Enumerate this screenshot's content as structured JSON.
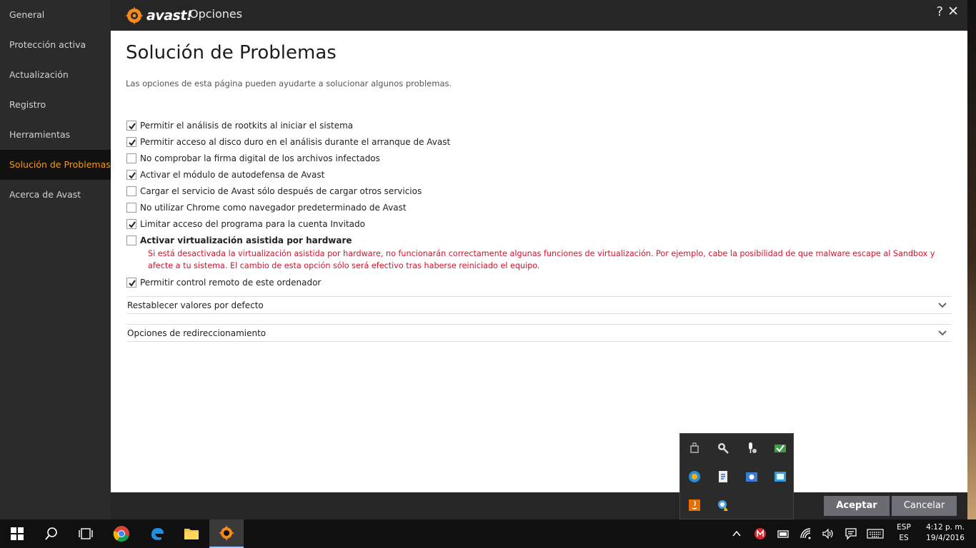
{
  "window": {
    "brand": "avast!",
    "title": "Opciones",
    "help_label": "?",
    "close_label": "✕"
  },
  "sidebar": {
    "items": [
      {
        "label": "General",
        "active": false
      },
      {
        "label": "Protección activa",
        "active": false
      },
      {
        "label": "Actualización",
        "active": false
      },
      {
        "label": "Registro",
        "active": false
      },
      {
        "label": "Herramientas",
        "active": false
      },
      {
        "label": "Solución de Problemas",
        "active": true
      },
      {
        "label": "Acerca de Avast",
        "active": false
      }
    ]
  },
  "main": {
    "title": "Solución de Problemas",
    "subtitle": "Las opciones de esta página pueden ayudarte a solucionar algunos problemas.",
    "options": [
      {
        "label": "Permitir el análisis de rootkits al iniciar el sistema",
        "checked": true
      },
      {
        "label": "Permitir acceso al disco duro en el análisis durante el arranque de Avast",
        "checked": true
      },
      {
        "label": "No comprobar la firma digital de los archivos infectados",
        "checked": false
      },
      {
        "label": "Activar el módulo de autodefensa de Avast",
        "checked": true
      },
      {
        "label": "Cargar el servicio de Avast sólo después de cargar otros servicios",
        "checked": false
      },
      {
        "label": "No utilizar Chrome como navegador predeterminado de Avast",
        "checked": false
      },
      {
        "label": "Limitar acceso del programa para la cuenta Invitado",
        "checked": true
      },
      {
        "label": "Activar virtualización asistida por hardware",
        "checked": false,
        "bold": true
      },
      {
        "label": "Permitir control remoto de este ordenador",
        "checked": true
      }
    ],
    "warning": "Si está desactivada la virtualización asistida por hardware, no funcionarán correctamente algunas funciones de virtualización. Por ejemplo, cabe la posibilidad de que malware escape al Sandbox y afecte a tu sistema. El cambio de esta opción sólo será efectivo tras haberse reiniciado el equipo.",
    "sections": [
      {
        "label": "Restablecer valores por defecto"
      },
      {
        "label": "Opciones de redireccionamiento"
      }
    ]
  },
  "buttons": {
    "accept": "Aceptar",
    "cancel": "Cancelar"
  },
  "colors": {
    "accent": "#f39a1e",
    "warning": "#d3132b",
    "sidebar_bg": "#2b2b2b"
  },
  "tray_popup": {
    "icons": [
      "usb-eject-icon",
      "sniffer-icon",
      "mic-settings-icon",
      "shield-check-icon",
      "browser-icon",
      "document-icon",
      "network-settings-icon",
      "monitor-icon",
      "java-icon",
      "search-warning-icon"
    ]
  },
  "taskbar": {
    "apps": [
      "start-icon",
      "search-icon",
      "task-view-icon",
      "chrome-icon",
      "edge-icon",
      "file-explorer-icon",
      "avast-icon"
    ],
    "language_top": "ESP",
    "language_bottom": "ES",
    "time": "4:12 p. m.",
    "date": "19/4/2016"
  }
}
